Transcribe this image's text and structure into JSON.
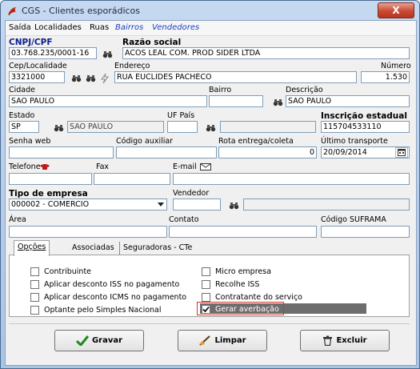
{
  "window": {
    "title": "CGS - Clientes esporádicos",
    "close": "X"
  },
  "menu": [
    "Saída",
    "Localidades",
    "Ruas",
    "Bairros",
    "Vendedores"
  ],
  "fields": {
    "cnpj_label": "CNPJ/CPF",
    "cnpj": "03.768.235/0001-16",
    "razao_label": "Razão social",
    "razao": "ACOS LEAL COM. PROD SIDER LTDA",
    "cep_label": "Cep/Localidade",
    "cep": "3321000",
    "endereco_label": "Endereço",
    "endereco": "RUA EUCLIDES PACHECO",
    "numero_label": "Número",
    "numero": "1.530",
    "cidade_label": "Cidade",
    "cidade": "SAO PAULO",
    "bairro_label": "Bairro",
    "bairro": "",
    "descricao_label": "Descrição",
    "descricao": "SAO PAULO",
    "estado_label": "Estado",
    "estado": "SP",
    "estado_nome": "SAO PAULO",
    "uf_pais_label": "UF País",
    "uf_pais": "",
    "uf_pais_nome": "",
    "inscricao_label": "Inscrição estadual",
    "inscricao": "115704533110",
    "senha_label": "Senha web",
    "senha": "",
    "codigo_aux_label": "Código auxiliar",
    "codigo_aux": "",
    "rota_label": "Rota entrega/coleta",
    "rota": "0",
    "ultimo_label": "Último transporte",
    "ultimo": "20/09/2014",
    "telefone_label": "Telefone",
    "fax_label": "Fax",
    "email_label": "E-mail",
    "telefone": "",
    "fax": "",
    "email": "",
    "tipo_label": "Tipo de empresa",
    "tipo": "000002 - COMERCIO",
    "vendedor_label": "Vendedor",
    "vendedor": "",
    "vendedor_nome": "",
    "area_label": "Área",
    "area": "",
    "contato_label": "Contato",
    "contato": "",
    "suframa_label": "Código SUFRAMA",
    "suframa": ""
  },
  "tabs": [
    "Opções",
    "Associadas",
    "Seguradoras - CTe"
  ],
  "options_left": [
    "Contribuinte",
    "Aplicar desconto ISS no pagamento",
    "Aplicar desconto ICMS no pagamento",
    "Optante pelo Simples Nacional"
  ],
  "options_right": [
    "Micro empresa",
    "Recolhe ISS",
    "Contratante do serviço",
    "Gerar averbação"
  ],
  "buttons": {
    "gravar": "Gravar",
    "limpar": "Limpar",
    "excluir": "Excluir"
  },
  "colors": {
    "accent_red": "#d93025",
    "highlight_row": "#6d6d6d"
  }
}
